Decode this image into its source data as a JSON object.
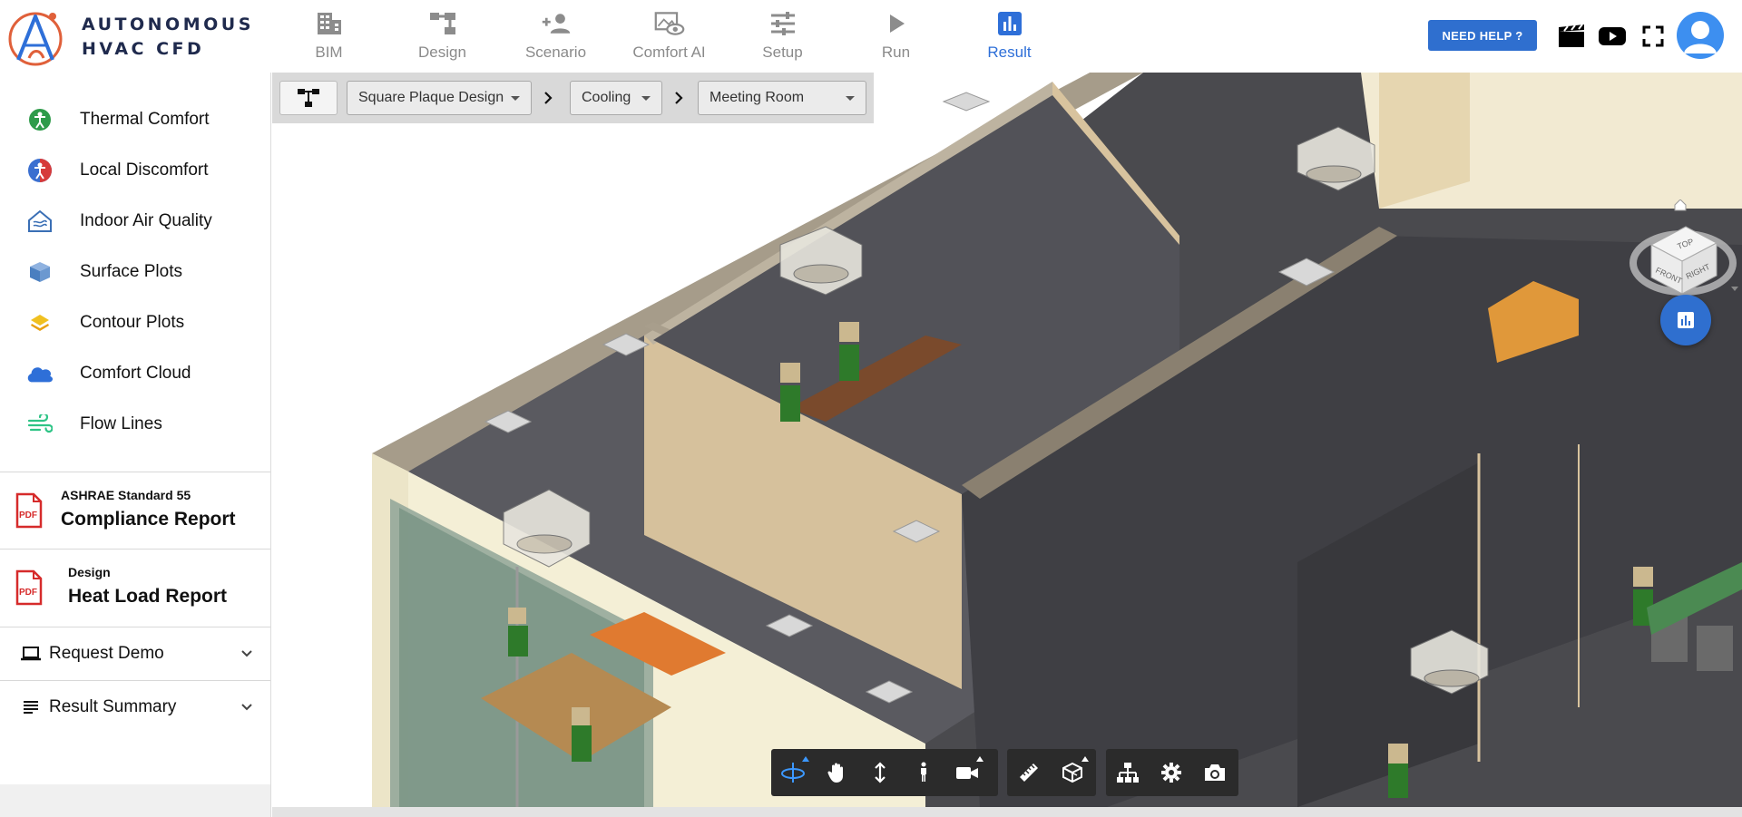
{
  "logo": {
    "line1": "AUTONOMOUS",
    "line2": "HVAC CFD"
  },
  "nav": [
    {
      "label": "BIM",
      "icon": "building-icon",
      "active": false
    },
    {
      "label": "Design",
      "icon": "design-icon",
      "active": false
    },
    {
      "label": "Scenario",
      "icon": "people-icon",
      "active": false
    },
    {
      "label": "Comfort AI",
      "icon": "eye-image-icon",
      "active": false
    },
    {
      "label": "Setup",
      "icon": "sliders-icon",
      "active": false
    },
    {
      "label": "Run",
      "icon": "play-icon",
      "active": false
    },
    {
      "label": "Result",
      "icon": "bar-chart-icon",
      "active": true
    }
  ],
  "header": {
    "help_label": "NEED HELP ?"
  },
  "sidebar": {
    "items": [
      {
        "label": "Thermal Comfort",
        "icon": "thermal-comfort-icon",
        "color": "#2e9b4a"
      },
      {
        "label": "Local Discomfort",
        "icon": "local-discomfort-icon",
        "color": "#d63a3a"
      },
      {
        "label": "Indoor Air Quality",
        "icon": "indoor-air-quality-icon",
        "color": "#3a6fb5"
      },
      {
        "label": "Surface Plots",
        "icon": "cube-icon",
        "color": "#4a7fc0"
      },
      {
        "label": "Contour Plots",
        "icon": "layers-icon",
        "color": "#e8b020"
      },
      {
        "label": "Comfort Cloud",
        "icon": "cloud-icon",
        "color": "#2e6fd8"
      },
      {
        "label": "Flow Lines",
        "icon": "wind-icon",
        "color": "#2ec486"
      }
    ],
    "reports": [
      {
        "sub": "ASHRAE Standard 55",
        "main": "Compliance Report",
        "icon": "pdf-icon"
      },
      {
        "sub": "Design",
        "main": "Heat Load Report",
        "icon": "pdf-icon"
      }
    ],
    "collapsibles": [
      {
        "label": "Request Demo",
        "icon": "laptop-icon"
      },
      {
        "label": "Result Summary",
        "icon": "list-icon"
      }
    ]
  },
  "breadcrumb": {
    "design": "Square Plaque Design",
    "mode": "Cooling",
    "room": "Meeting Room"
  },
  "viewcube": {
    "top": "TOP",
    "front": "FRONT",
    "right": "RIGHT"
  },
  "toolbar": {
    "groups": [
      [
        "orbit-icon",
        "pan-icon",
        "zoom-icon",
        "walk-icon",
        "camera-icon"
      ],
      [
        "measure-icon",
        "section-icon"
      ],
      [
        "model-tree-icon",
        "settings-icon",
        "screenshot-icon"
      ]
    ]
  },
  "colors": {
    "accent": "#2e6fd8",
    "help_button": "#2f6fcf",
    "toolbar": "#2b2b2b"
  }
}
